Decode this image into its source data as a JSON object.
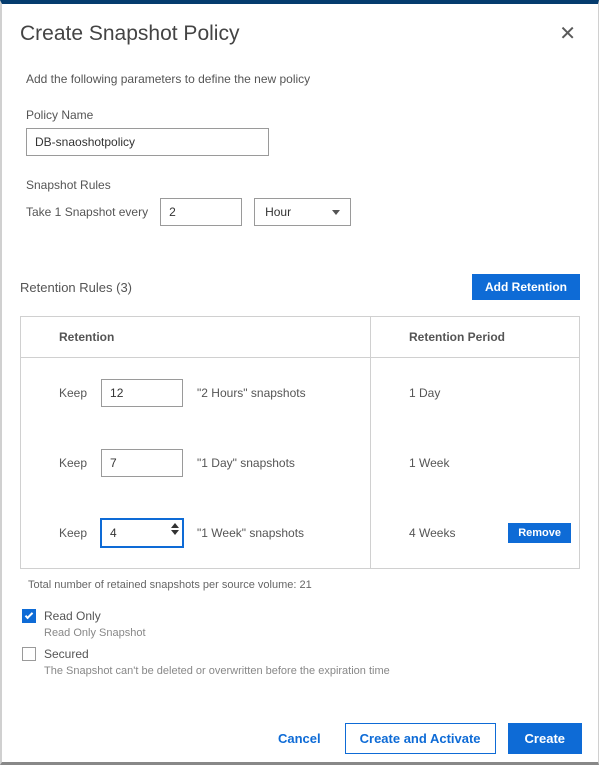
{
  "header": {
    "title": "Create Snapshot Policy"
  },
  "intro": "Add the following parameters to define the new policy",
  "policy": {
    "label": "Policy Name",
    "value": "DB-snaoshotpolicy"
  },
  "snapshot_rules": {
    "label": "Snapshot Rules",
    "prefix": "Take 1 Snapshot every",
    "interval": "2",
    "unit": "Hour"
  },
  "retention_section": {
    "title": "Retention Rules (3)",
    "add_button": "Add Retention"
  },
  "table": {
    "col_retention": "Retention",
    "col_period": "Retention Period",
    "keep_label": "Keep",
    "remove_label": "Remove",
    "rows": [
      {
        "count": "12",
        "unit": "\"2 Hours\" snapshots",
        "period": "1 Day",
        "active": false,
        "removable": false
      },
      {
        "count": "7",
        "unit": "\"1 Day\" snapshots",
        "period": "1 Week",
        "active": false,
        "removable": false
      },
      {
        "count": "4",
        "unit": "\"1 Week\" snapshots",
        "period": "4 Weeks",
        "active": true,
        "removable": true
      }
    ],
    "footer": "Total number of retained snapshots per source volume: 21"
  },
  "options": {
    "read_only": {
      "label": "Read Only",
      "sub": "Read Only Snapshot",
      "checked": true
    },
    "secured": {
      "label": "Secured",
      "sub": "The Snapshot can't be deleted or overwritten before the expiration time",
      "checked": false
    }
  },
  "footer": {
    "cancel": "Cancel",
    "create_activate": "Create and Activate",
    "create": "Create"
  }
}
